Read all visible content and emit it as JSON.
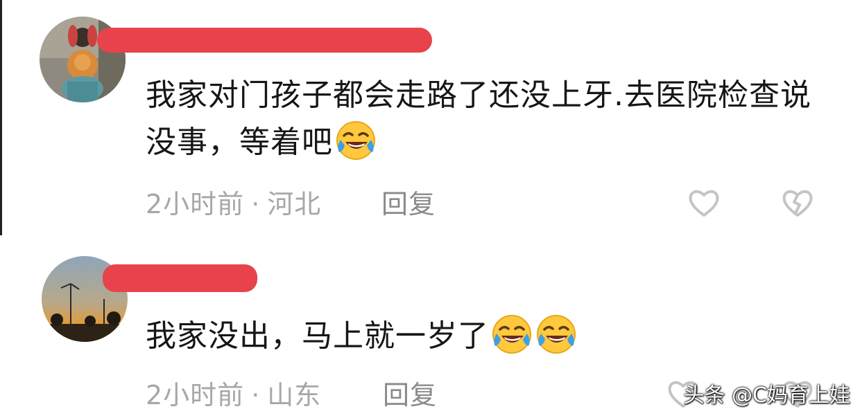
{
  "comments": [
    {
      "text": "我家对门孩子都会走路了还没上牙.去医院检查说没事，等着吧",
      "emoji": "rofl-emoji",
      "time": "2小时前",
      "separator": "·",
      "location": "河北",
      "reply_label": "回复",
      "like_icon": "heart-outline-icon",
      "dislike_icon": "broken-heart-icon"
    },
    {
      "text": "我家没出，马上就一岁了",
      "emoji": "rofl-emoji",
      "time": "2小时前",
      "separator": "·",
      "location": "山东",
      "reply_label": "回复",
      "like_icon": "heart-outline-icon",
      "dislike_icon": "broken-heart-icon"
    }
  ],
  "watermark": "头条 @C妈育上娃",
  "colors": {
    "redaction": "#e8424a",
    "text": "#161616",
    "meta": "#a7a7a7",
    "icon": "#c4c4c4"
  }
}
